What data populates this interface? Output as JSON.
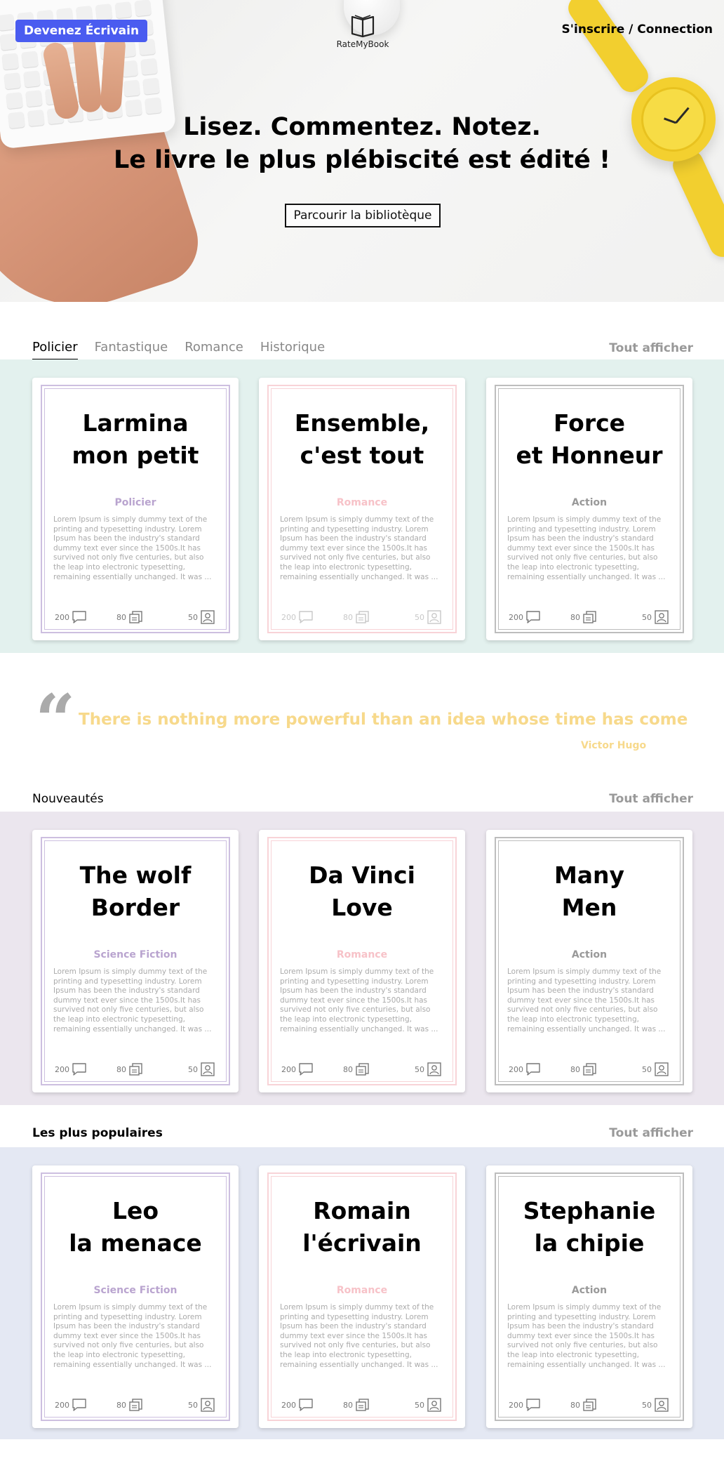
{
  "header": {
    "writer_button": "Devenez Écrivain",
    "logo_text": "RateMyBook",
    "auth_link": "S'inscrire / Connection",
    "hero_line1": "Lisez. Commentez. Notez.",
    "hero_line2": "Le livre le plus plébiscité est édité !",
    "browse_button": "Parcourir la bibliotèque"
  },
  "categories": {
    "tabs": [
      "Policier",
      "Fantastique",
      "Romance",
      "Historique"
    ],
    "active_tab": "Policier",
    "see_all": "Tout afficher",
    "band_color": "#e3f1ee",
    "books": [
      {
        "title_1": "Larmina",
        "title_2": "mon petit",
        "genre": "Policier",
        "genre_color": "#b9a4cf",
        "border_color": "#cdbfe0",
        "desc": "Lorem Ipsum is simply dummy text of the printing and typesetting industry. Lorem Ipsum has been the industry's standard dummy text ever since the 1500s.It has survived not only five centuries, but also the leap into electronic typesetting, remaining essentially unchanged. It was ...",
        "comments": "200",
        "reviews": "80",
        "readers": "50"
      },
      {
        "title_1": "Ensemble,",
        "title_2": "c'est tout",
        "genre": "Romance",
        "genre_color": "#f7c2c8",
        "border_color": "#f8d3d7",
        "desc": "Lorem Ipsum is simply dummy text of the printing and typesetting industry. Lorem Ipsum has been the industry's standard dummy text ever since the 1500s.It has survived not only five centuries, but also the leap into electronic typesetting, remaining essentially unchanged. It was ...",
        "comments": "200",
        "reviews": "80",
        "readers": "50"
      },
      {
        "title_1": "Force",
        "title_2": "et Honneur",
        "genre": "Action",
        "genre_color": "#999999",
        "border_color": "#bdbdbd",
        "desc": "Lorem Ipsum is simply dummy text of the printing and typesetting industry. Lorem Ipsum has been the industry's standard dummy text ever since the 1500s.It has survived not only five centuries, but also the leap into electronic typesetting, remaining essentially unchanged. It was ...",
        "comments": "200",
        "reviews": "80",
        "readers": "50"
      }
    ]
  },
  "quote": {
    "text": "There is nothing more powerful than an idea whose time has come",
    "author": "Victor Hugo",
    "color": "#f7d98b"
  },
  "new_releases": {
    "label": "Nouveautés",
    "see_all": "Tout afficher",
    "band_color": "#ebe6ee",
    "books": [
      {
        "title_1": "The wolf",
        "title_2": "Border",
        "genre": "Science Fiction",
        "genre_color": "#b9a4cf",
        "border_color": "#cdbfe0",
        "desc": "Lorem Ipsum is simply dummy text of the printing and typesetting industry. Lorem Ipsum has been the industry's standard dummy text ever since the 1500s.It has survived not only five centuries, but also the leap into electronic typesetting, remaining essentially unchanged. It was ...",
        "comments": "200",
        "reviews": "80",
        "readers": "50"
      },
      {
        "title_1": "Da Vinci",
        "title_2": "Love",
        "genre": "Romance",
        "genre_color": "#f7c2c8",
        "border_color": "#f8d3d7",
        "desc": "Lorem Ipsum is simply dummy text of the printing and typesetting industry. Lorem Ipsum has been the industry's standard dummy text ever since the 1500s.It has survived not only five centuries, but also the leap into electronic typesetting, remaining essentially unchanged. It was ...",
        "comments": "200",
        "reviews": "80",
        "readers": "50"
      },
      {
        "title_1": "Many",
        "title_2": "Men",
        "genre": "Action",
        "genre_color": "#999999",
        "border_color": "#bdbdbd",
        "desc": "Lorem Ipsum is simply dummy text of the printing and typesetting industry. Lorem Ipsum has been the industry's standard dummy text ever since the 1500s.It has survived not only five centuries, but also the leap into electronic typesetting, remaining essentially unchanged. It was ...",
        "comments": "200",
        "reviews": "80",
        "readers": "50"
      }
    ]
  },
  "popular": {
    "label": "Les plus populaires",
    "see_all": "Tout afficher",
    "band_color": "#e4e8f3",
    "books": [
      {
        "title_1": "Leo",
        "title_2": "la menace",
        "genre": "Science Fiction",
        "genre_color": "#b9a4cf",
        "border_color": "#cdbfe0",
        "desc": "Lorem Ipsum is simply dummy text of the printing and typesetting industry. Lorem Ipsum has been the industry's standard dummy text ever since the 1500s.It has survived not only five centuries, but also the leap into electronic typesetting, remaining essentially unchanged. It was ...",
        "comments": "200",
        "reviews": "80",
        "readers": "50"
      },
      {
        "title_1": "Romain",
        "title_2": "l'écrivain",
        "genre": "Romance",
        "genre_color": "#f7c2c8",
        "border_color": "#f8d3d7",
        "desc": "Lorem Ipsum is simply dummy text of the printing and typesetting industry. Lorem Ipsum has been the industry's standard dummy text ever since the 1500s.It has survived not only five centuries, but also the leap into electronic typesetting, remaining essentially unchanged. It was ...",
        "comments": "200",
        "reviews": "80",
        "readers": "50"
      },
      {
        "title_1": "Stephanie",
        "title_2": "la chipie",
        "genre": "Action",
        "genre_color": "#999999",
        "border_color": "#bdbdbd",
        "desc": "Lorem Ipsum is simply dummy text of the printing and typesetting industry. Lorem Ipsum has been the industry's standard dummy text ever since the 1500s.It has survived not only five centuries, but also the leap into electronic typesetting, remaining essentially unchanged. It was ...",
        "comments": "200",
        "reviews": "80",
        "readers": "50"
      }
    ]
  },
  "icons": {
    "comment": "comment-icon",
    "review": "review-icon",
    "reader": "reader-icon",
    "logo": "open-book-icon",
    "quote": "quote-icon"
  },
  "colors": {
    "accent": "#4a5cf0",
    "muted": "#999999"
  }
}
